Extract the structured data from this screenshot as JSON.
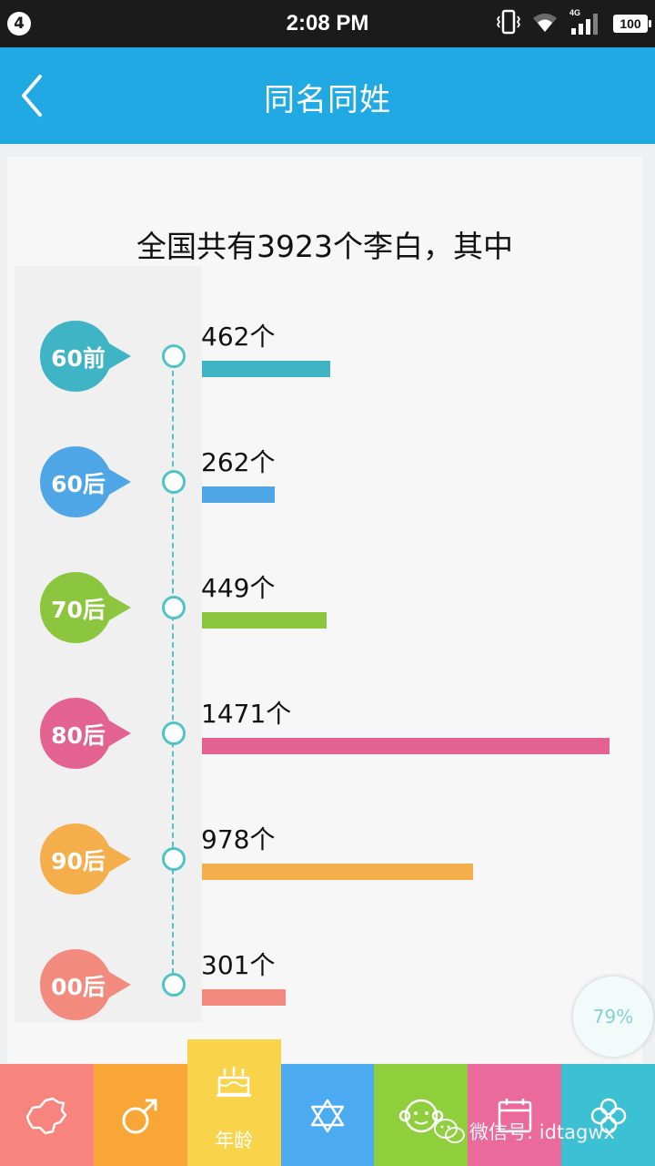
{
  "status_bar": {
    "notification_count": "4",
    "time": "2:08 PM",
    "network": "4G",
    "battery": "100"
  },
  "app_bar": {
    "title": "同名同姓"
  },
  "summary": {
    "headline": "全国共有3923个李白，其中"
  },
  "chart_data": {
    "type": "bar",
    "orientation": "horizontal",
    "categories": [
      "60前",
      "60后",
      "70后",
      "80后",
      "90后",
      "00后"
    ],
    "values": [
      462,
      262,
      449,
      1471,
      978,
      301
    ],
    "value_labels": [
      "462个",
      "262个",
      "449个",
      "1471个",
      "978个",
      "301个"
    ],
    "colors": [
      "#3fb4c4",
      "#4ea6e6",
      "#8cc63f",
      "#e4628f",
      "#f4ae4c",
      "#f28a7e"
    ],
    "xlim": [
      0,
      1471
    ],
    "grid": false,
    "legend": "none"
  },
  "progress": {
    "label": "79%",
    "value": 79
  },
  "bottom_tabs": [
    {
      "icon": "china-map-icon",
      "label": "",
      "color": "#f7857d"
    },
    {
      "icon": "gender-icon",
      "label": "",
      "color": "#f8a636"
    },
    {
      "icon": "birthday-cake-icon",
      "label": "年龄",
      "color": "#f9d34a"
    },
    {
      "icon": "star-of-david-icon",
      "label": "",
      "color": "#4caaf0"
    },
    {
      "icon": "monkey-face-icon",
      "label": "",
      "color": "#8fcf3c"
    },
    {
      "icon": "calendar-icon",
      "label": "",
      "color": "#ea6a9b"
    },
    {
      "icon": "clover-icon",
      "label": "",
      "color": "#3cc0d4"
    }
  ],
  "watermark": {
    "text": "微信号: idtagwx"
  }
}
